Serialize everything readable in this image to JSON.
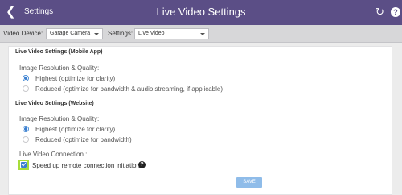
{
  "header": {
    "back_label": "Settings",
    "title": "Live Video Settings",
    "back_icon": "chevron-left-icon",
    "refresh_icon": "refresh-icon",
    "help_icon": "help-icon",
    "help_glyph": "?",
    "bg_color": "#5b4e86"
  },
  "toolbar": {
    "device_label": "Video Device:",
    "device_value": "Garage Camera",
    "settings_label": "Settings:",
    "settings_value": "Live Video"
  },
  "mobile": {
    "title": "Live Video Settings (Mobile App)",
    "resolution_label": "Image Resolution & Quality:",
    "options": [
      {
        "label": "Highest (optimize for clarity)",
        "selected": true
      },
      {
        "label": "Reduced (optimize for bandwidth & audio streaming, if applicable)",
        "selected": false
      }
    ]
  },
  "website": {
    "title": "Live Video Settings (Website)",
    "resolution_label": "Image Resolution & Quality:",
    "options": [
      {
        "label": "Highest (optimize for clarity)",
        "selected": true
      },
      {
        "label": "Reduced (optimize for bandwidth)",
        "selected": false
      }
    ]
  },
  "connection": {
    "label": "Live Video Connection :",
    "checkbox_label": "Speed up remote connection initiation",
    "checked": true,
    "help_glyph": "?"
  },
  "save_label": "SAVE",
  "colors": {
    "accent": "#3b7fd0",
    "highlight": "#a7dd3a",
    "save_button": "#8fbce9"
  }
}
